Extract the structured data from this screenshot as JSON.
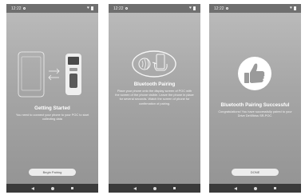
{
  "screens": [
    {
      "status": {
        "time": "12:22",
        "heart": "♥"
      },
      "title": "Getting Started",
      "description": "You need to connect your phone to your POC to start collecting data",
      "button": "Begin Pairing",
      "illustration": "phone-device-sync"
    },
    {
      "status": {
        "time": "12:22",
        "heart": "♥"
      },
      "title": "Bluetooth Pairing",
      "description": "Place your phone onto the display screen of POC with the screen of the phone visible. Leave the phone in place for several seconds. Watch the screen of phone for confirmation of pairing.",
      "illustration": "hand-phone-contactless"
    },
    {
      "status": {
        "time": "12:22",
        "heart": "♥"
      },
      "title": "Bluetooth Pairing Successful",
      "description": "Congratulations! You have successfully paired to your Drive DeVilbiss SR-POC.",
      "button": "DONE",
      "illustration": "thumbs-up"
    }
  ]
}
